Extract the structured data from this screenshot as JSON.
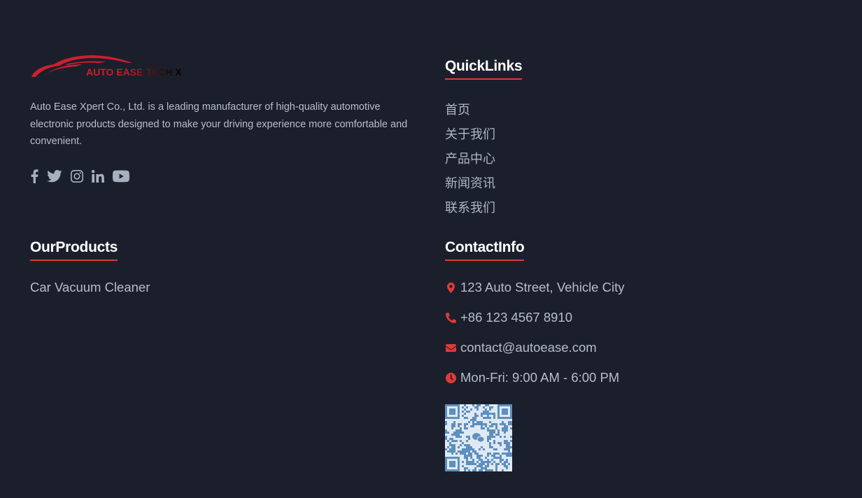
{
  "brand": {
    "logo_text": "AUTO EASE TECH X",
    "description": "Auto Ease Xpert Co., Ltd. is a leading manufacturer of high-quality automotive electronic products designed to make your driving experience more comfortable and convenient.",
    "accent_color": "#e03a3a"
  },
  "social": [
    {
      "name": "facebook-icon"
    },
    {
      "name": "twitter-icon"
    },
    {
      "name": "instagram-icon"
    },
    {
      "name": "linkedin-icon"
    },
    {
      "name": "youtube-icon"
    }
  ],
  "quick_links": {
    "title": "QuickLinks",
    "items": [
      "首页",
      "关于我们",
      "产品中心",
      "新闻资讯",
      "联系我们"
    ]
  },
  "products": {
    "title": "OurProducts",
    "items": [
      "Car Vacuum Cleaner"
    ]
  },
  "contact": {
    "title": "ContactInfo",
    "items": [
      {
        "icon": "map-marker-icon",
        "text": "123 Auto Street, Vehicle City"
      },
      {
        "icon": "phone-icon",
        "text": "+86 123 4567 8910"
      },
      {
        "icon": "envelope-icon",
        "text": "contact@autoease.com"
      },
      {
        "icon": "clock-icon",
        "text": "Mon-Fri: 9:00 AM - 6:00 PM"
      }
    ],
    "qr_icon": "wechat-icon"
  }
}
